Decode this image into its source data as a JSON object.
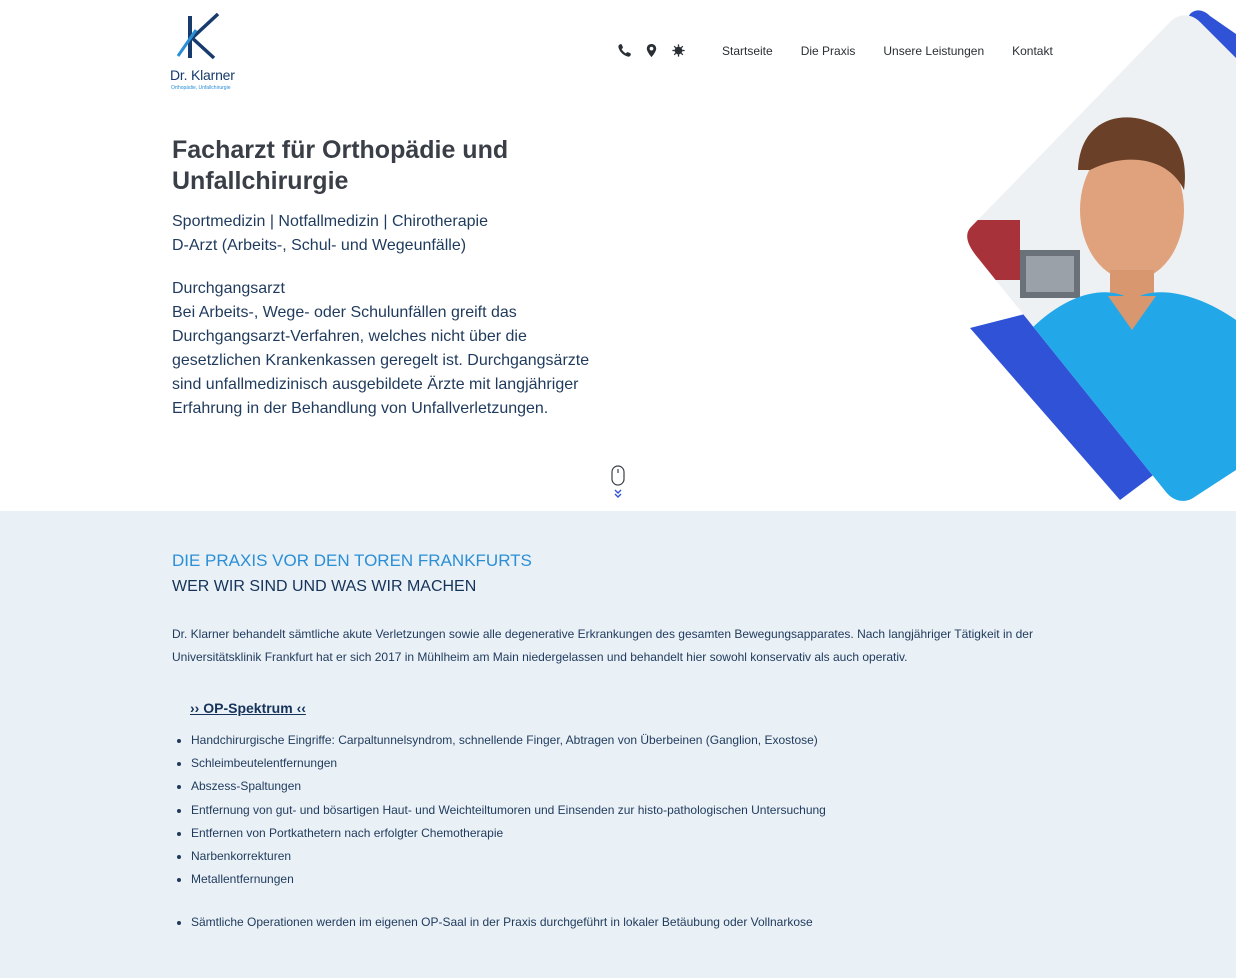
{
  "logo": {
    "name": "Dr. Klarner",
    "subtitle": "Orthopädie, Unfallchirurgie",
    "brand_dark": "#173b6c",
    "brand_light": "#2b8fd6"
  },
  "header": {
    "icons": [
      "phone-icon",
      "location-pin-icon",
      "covid-virus-icon"
    ],
    "nav": [
      "Startseite",
      "Die Praxis",
      "Unsere Leistungen",
      "Kontakt"
    ]
  },
  "hero": {
    "title": "Facharzt für Orthopädie und Unfallchirurgie",
    "subtitle_line1": "Sportmedizin | Notfallmedizin | Chirotherapie",
    "subtitle_line2": "D-Arzt (Arbeits-, Schul- und Wegeunfälle)",
    "body_heading": "Durchgangsarzt",
    "body_text": "Bei Arbeits-, Wege- oder Schulunfällen greift das Durchgangsarzt-Verfahren, welches nicht über die gesetzlichen Krankenkassen geregelt ist. Durchgangsärzte sind unfallmedizinisch ausgebildete Ärzte mit langjähriger Erfahrung in der Behandlung von Unfallverletzungen.",
    "accent_blue": "#2f52d6",
    "accent_cyan": "#22a7e8"
  },
  "practice": {
    "heading": "DIE PRAXIS VOR DEN TOREN FRANKFURTS",
    "subheading": "WER WIR SIND UND WAS WIR MACHEN",
    "text": "Dr. Klarner behandelt sämtliche akute Verletzungen sowie alle degenerative Erkrankungen des gesamten Bewegungsapparates. Nach langjähriger Tätigkeit in der Universitätsklinik Frankfurt hat er sich 2017 in Mühlheim am Main niedergelassen und behandelt hier sowohl konservativ als auch operativ.",
    "op_link": "›› OP-Spektrum ‹‹",
    "op_items": [
      "Handchirurgische Eingriffe: Carpaltunnelsyndrom, schnellende Finger, Abtragen von Überbeinen (Ganglion, Exostose)",
      "Schleimbeutelentfernungen",
      "Abszess-Spaltungen",
      "Entfernung von gut- und bösartigen Haut- und Weichteiltumoren und Einsenden zur histo-pathologischen Untersuchung",
      "Entfernen von Portkathetern nach erfolgter Chemotherapie",
      "Narbenkorrekturen",
      "Metallentfernungen"
    ],
    "op_note": "Sämtliche Operationen werden im eigenen OP-Saal in der Praxis durchgeführt in lokaler Betäubung oder Vollnarkose",
    "background": "#e9f0f6"
  }
}
